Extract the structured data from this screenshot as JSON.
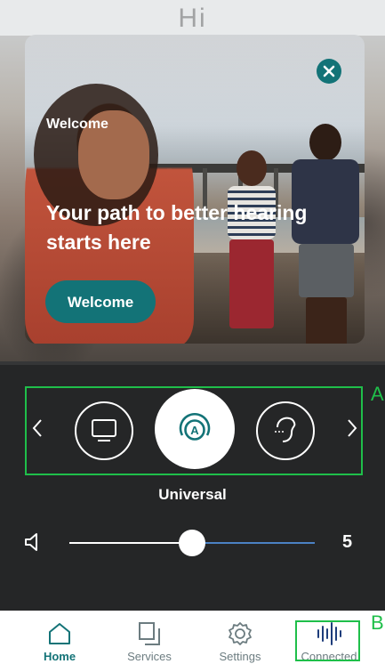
{
  "background": {
    "top_title": "Hi"
  },
  "card": {
    "eyebrow": "Welcome",
    "headline": "Your path to better hearing starts here",
    "button_label": "Welcome"
  },
  "programs": {
    "items": [
      {
        "icon": "tv-icon"
      },
      {
        "icon": "universal-program-icon",
        "selected": true
      },
      {
        "icon": "ear-icon"
      }
    ],
    "selected_label": "Universal"
  },
  "volume": {
    "value": "5",
    "level_fraction": 0.5
  },
  "nav": {
    "items": [
      {
        "label": "Home",
        "icon": "home-icon",
        "active": true
      },
      {
        "label": "Services",
        "icon": "services-icon"
      },
      {
        "label": "Settings",
        "icon": "gear-icon"
      },
      {
        "label": "Connected",
        "icon": "connected-wave-icon"
      }
    ]
  },
  "annotations": {
    "a": "A",
    "b": "B"
  },
  "colors": {
    "accent": "#137377",
    "annotation": "#1fbf4a",
    "panel": "#252627",
    "slider_right": "#4b82c4"
  }
}
